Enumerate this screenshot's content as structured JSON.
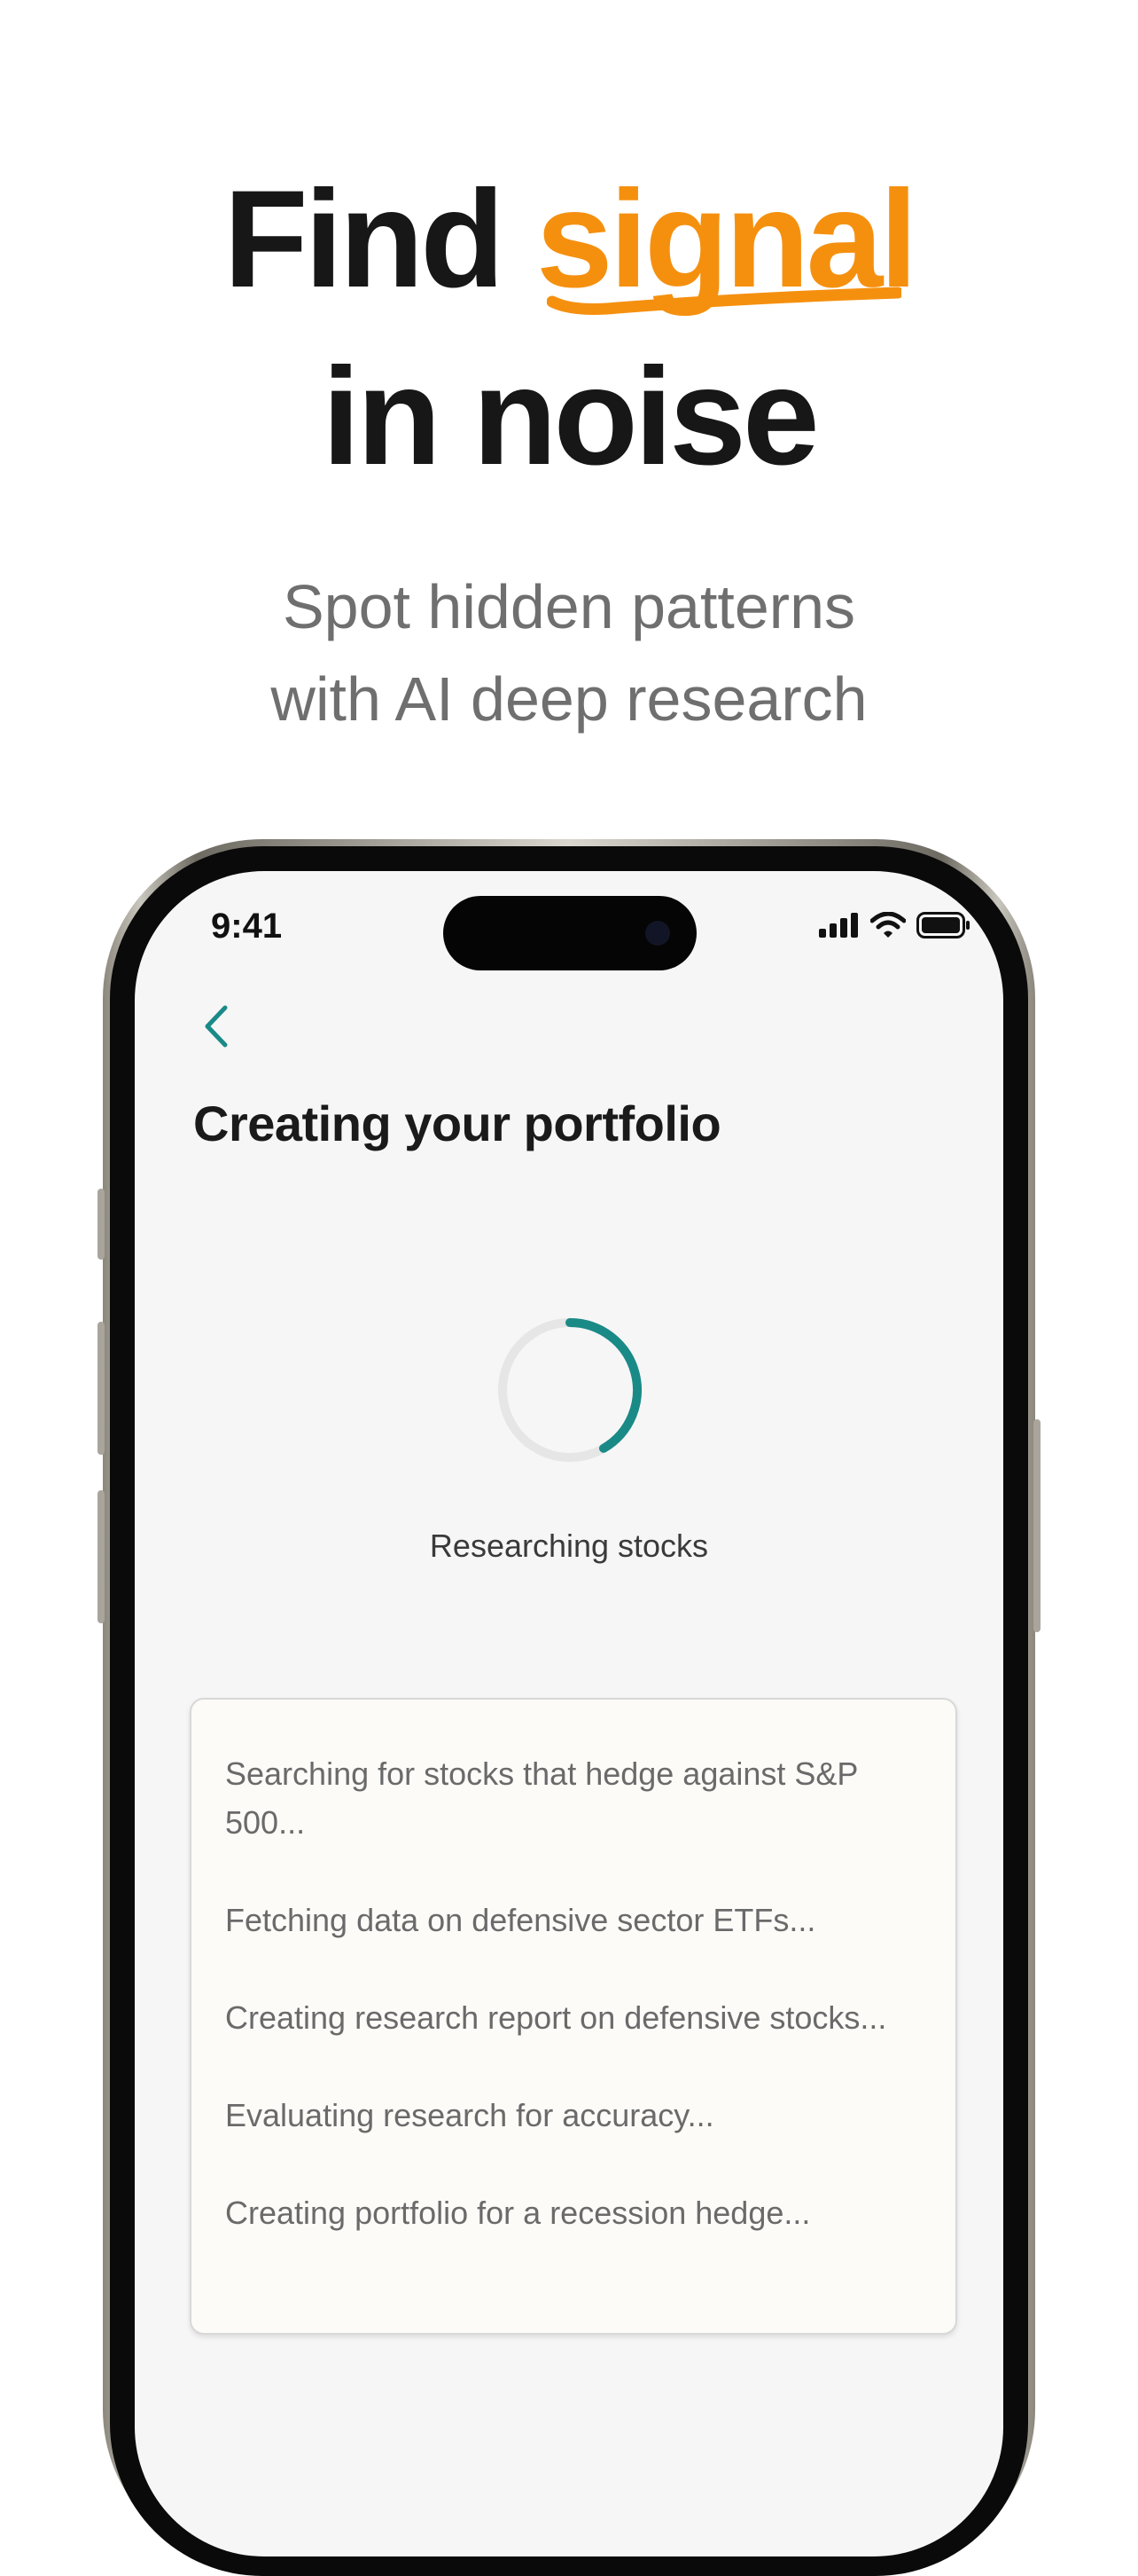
{
  "hero": {
    "title_part1": "Find",
    "title_accent": "signal",
    "title_line2": "in noise",
    "subtitle_line1": "Spot hidden patterns",
    "subtitle_line2": "with AI deep research",
    "accent_color": "#f5900f"
  },
  "status_bar": {
    "time": "9:41",
    "icons": [
      "cellular-signal-icon",
      "wifi-icon",
      "battery-icon"
    ]
  },
  "screen": {
    "back_icon": "chevron-left-icon",
    "title": "Creating your portfolio",
    "spinner_label": "Researching stocks",
    "spinner_color": "#1a8a87",
    "log_items": [
      "Searching for stocks that hedge against S&P 500...",
      "Fetching data on defensive sector ETFs...",
      "Creating research report on defensive stocks...",
      "Evaluating research for accuracy...",
      "Creating portfolio for a recession hedge..."
    ]
  }
}
